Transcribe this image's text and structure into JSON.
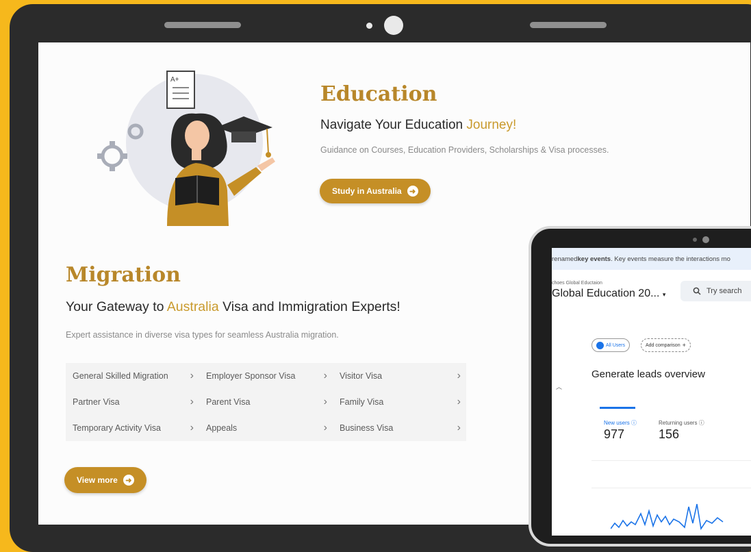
{
  "education": {
    "title": "Education",
    "subtitle_before": "Navigate Your Education ",
    "subtitle_accent": "Journey!",
    "description": "Guidance on Courses, Education Providers, Scholarships & Visa processes.",
    "cta_label": "Study in Australia",
    "illustration_grade": "A+"
  },
  "migration": {
    "title": "Migration",
    "subtitle_before": "Your Gateway to ",
    "subtitle_accent": "Australia",
    "subtitle_after": " Visa and Immigration Experts!",
    "description": "Expert assistance in diverse visa types for seamless Australia migration.",
    "visa_rows": [
      [
        "General Skilled Migration",
        "Employer Sponsor Visa",
        "Visitor Visa"
      ],
      [
        "Partner Visa",
        "Parent Visa",
        "Family Visa"
      ],
      [
        "Temporary Activity Visa",
        "Appeals",
        "Business Visa"
      ]
    ],
    "view_more_label": "View more"
  },
  "analytics": {
    "banner_prefix": "renamed ",
    "banner_bold": "key events",
    "banner_suffix": ". Key events measure the interactions mo",
    "property_small": "choes Global Eductaion",
    "property_name": "Global Education 20...",
    "search_placeholder": "Try search",
    "all_users_chip": "All Users",
    "add_comparison_chip": "Add comparison",
    "page_heading": "Generate leads overview",
    "metrics": [
      {
        "label": "New users",
        "value": "977"
      },
      {
        "label": "Returning users",
        "value": "156"
      }
    ]
  },
  "colors": {
    "background": "#f6b81c",
    "brand_gold": "#b8872a",
    "button": "#c58f26",
    "analytics_blue": "#1a73e8"
  },
  "icons": [
    "arrow-right-circle-icon",
    "chevron-right-icon",
    "search-icon",
    "help-circle-icon",
    "dropdown-caret-icon",
    "plus-icon",
    "gear-icon",
    "graduation-cap-icon",
    "report-card-icon"
  ]
}
